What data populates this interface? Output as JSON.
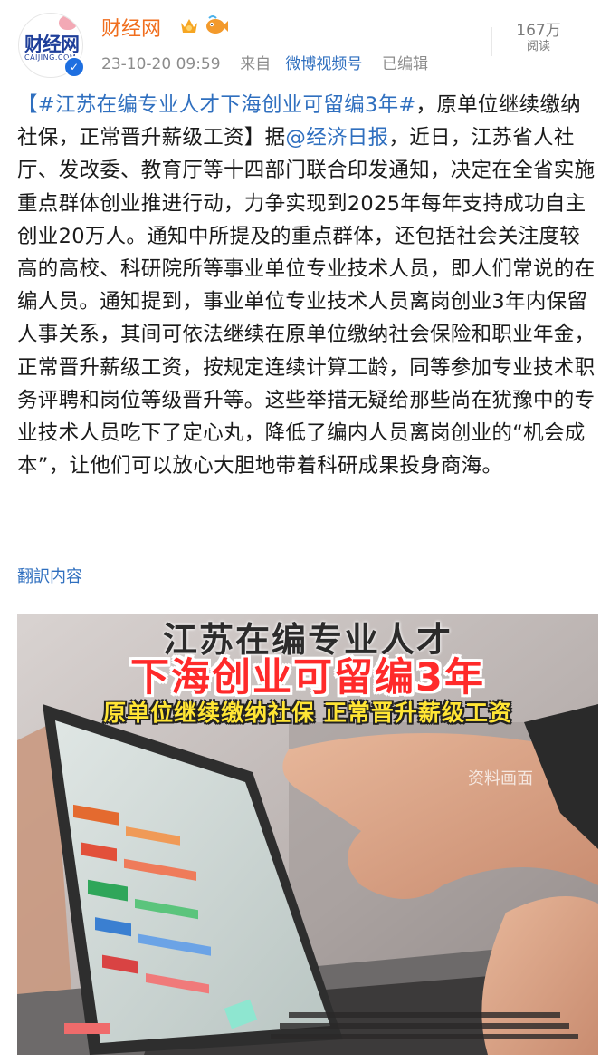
{
  "header": {
    "user_name": "财经网",
    "avatar_text": "财经网",
    "avatar_sub": "CAIJING.COM",
    "date": "23-10-20 09:59",
    "source_prefix": "来自",
    "source": "微博视频号",
    "edited": "已编辑",
    "read_count": "167万",
    "read_label": "阅读"
  },
  "post": {
    "hashtag": "【#江苏在编专业人才下海创业可留编3年#",
    "text_1": "，原单位继续缴纳社保，正常晋升薪级工资】据",
    "mention": "@经济日报",
    "text_2": "，近日，江苏省人社厅、发改委、教育厅等十四部门联合印发通知，决定在全省实施重点群体创业推进行动，力争实现到2025年每年支持成功自主创业20万人。通知中所提及的重点群体，还包括社会关注度较高的高校、科研院所等事业单位专业技术人员，即人们常说的在编人员。通知提到，事业单位专业技术人员离岗创业3年内保留人事关系，其间可依法继续在原单位缴纳社会保险和职业年金，正常晋升薪级工资，按规定连续计算工龄，同等参加专业技术职务评聘和岗位等级晋升等。这些举措无疑给那些尚在犹豫中的专业技术人员吃下了定心丸，降低了编内人员离岗创业的“机会成本”，让他们可以放心大胆地带着科研成果投身商海。",
    "translate": "翻訳内容"
  },
  "media": {
    "caption_1": "江苏在编专业人才",
    "caption_2": "下海创业可留编3年",
    "caption_3": "原单位继续缴纳社保 正常晋升薪级工资",
    "watermark": "资料画面"
  },
  "colors": {
    "orange_name": "#f06e1e",
    "link_blue": "#2f6fbf",
    "caption_red": "#ff2a2a",
    "caption_yellow": "#ffe534"
  }
}
